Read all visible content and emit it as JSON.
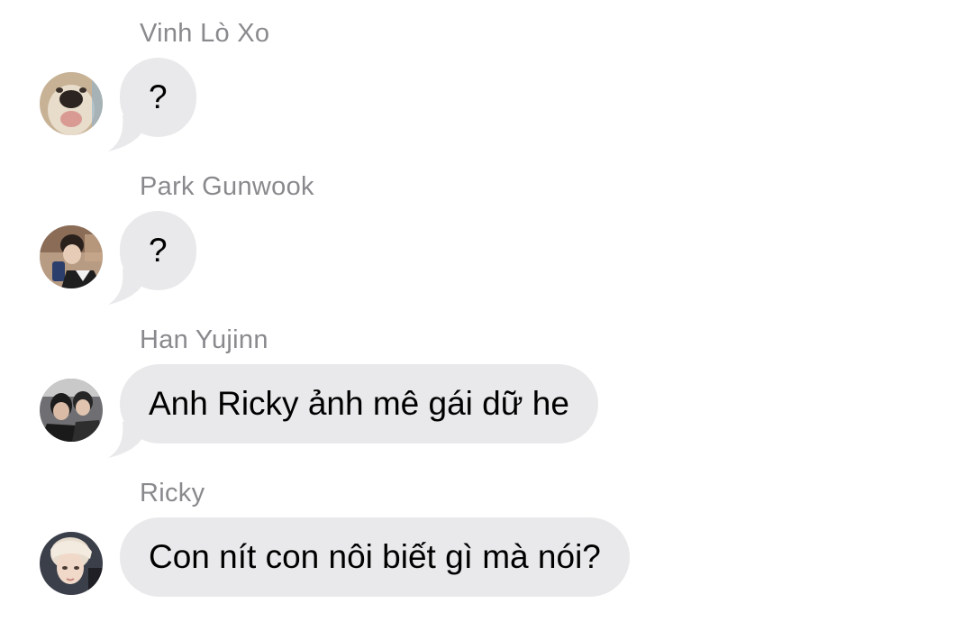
{
  "messages": [
    {
      "sender": "Vinh Lò Xo",
      "text": "?",
      "avatar_icon": "dog-avatar-icon",
      "show_tail": true
    },
    {
      "sender": "Park Gunwook",
      "text": "?",
      "avatar_icon": "person-selfie-avatar-icon",
      "show_tail": true
    },
    {
      "sender": "Han Yujinn",
      "text": "Anh Ricky ảnh mê gái dữ he",
      "avatar_icon": "two-people-avatar-icon",
      "show_tail": true
    },
    {
      "sender": "Ricky",
      "text": "Con nít con nôi biết gì mà nói?",
      "avatar_icon": "blonde-person-avatar-icon",
      "show_tail": false
    }
  ],
  "colors": {
    "bubble_background": "#e9e9eb",
    "sender_name": "#8a8a8e",
    "message_text": "#000000",
    "page_background": "#ffffff"
  }
}
